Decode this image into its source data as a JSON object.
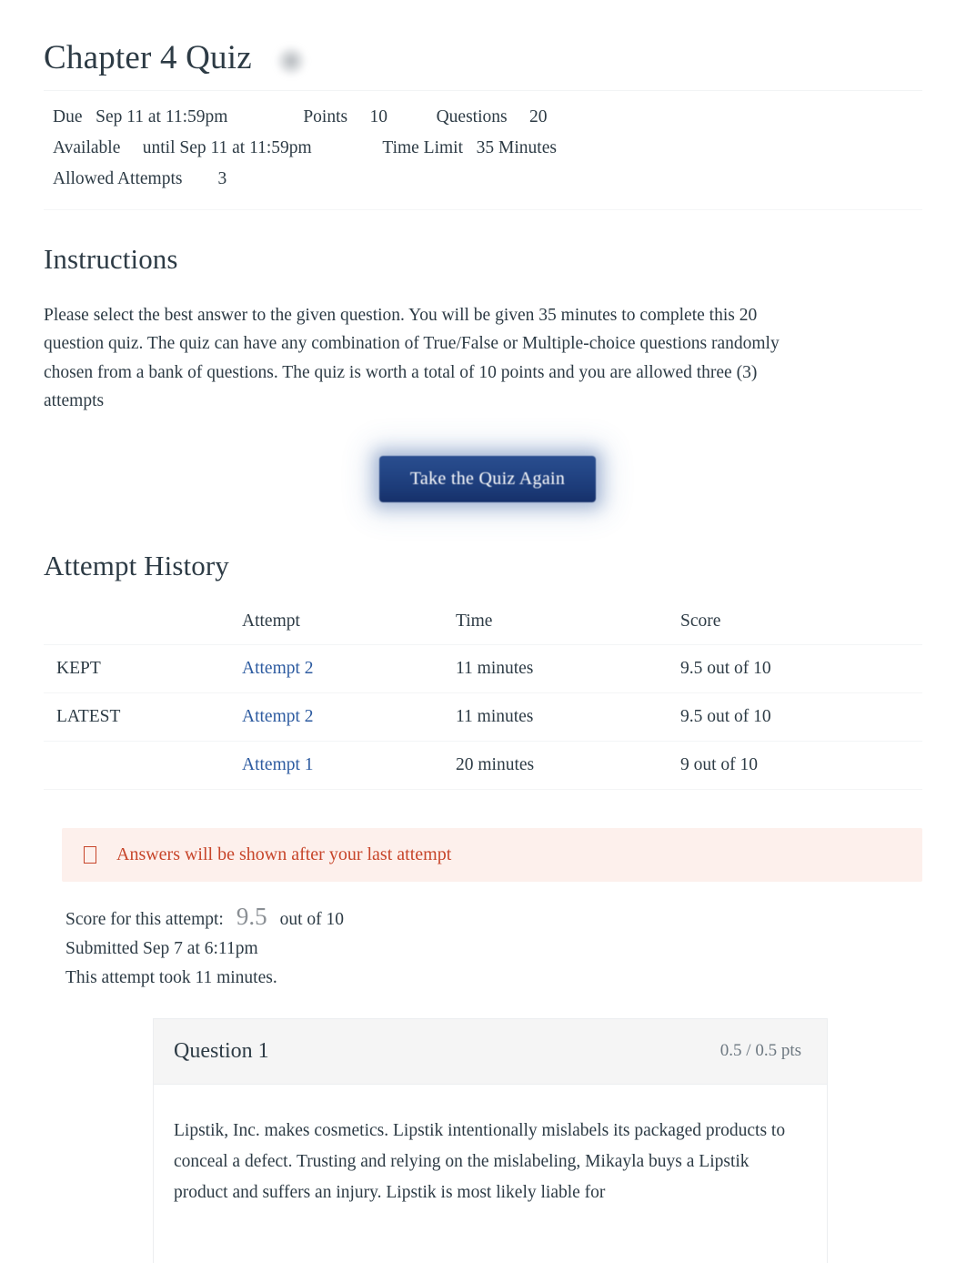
{
  "header": {
    "title": "Chapter 4 Quiz",
    "decoration_icon": "blurred-gray-blob-icon"
  },
  "quiz_meta": {
    "line1": "Due   Sep 11 at 11:59pm                 Points     10           Questions     20",
    "line2": "Available     until Sep 11 at 11:59pm                Time Limit   35 Minutes",
    "line3": "Allowed Attempts        3",
    "fields": {
      "due_label": "Due",
      "due_value": "Sep 11 at 11:59pm",
      "points_label": "Points",
      "points_value": "10",
      "questions_label": "Questions",
      "questions_value": "20",
      "available_label": "Available",
      "available_value": "until Sep 11 at 11:59pm",
      "time_limit_label": "Time Limit",
      "time_limit_value": "35 Minutes",
      "allowed_attempts_label": "Allowed Attempts",
      "allowed_attempts_value": "3"
    }
  },
  "instructions": {
    "heading": "Instructions",
    "body": "Please select the best answer to the given question. You will be given 35 minutes to complete this 20 question quiz. The quiz can have any combination of True/False or Multiple-choice questions randomly chosen from a bank of questions. The quiz is worth a total of 10 points and you are allowed three (3) attempts"
  },
  "actions": {
    "take_quiz_again": "Take the Quiz Again"
  },
  "attempt_history": {
    "heading": "Attempt History",
    "columns": [
      "",
      "Attempt",
      "Time",
      "Score"
    ],
    "rows": [
      {
        "label": "KEPT",
        "attempt": "Attempt 2",
        "time": "11 minutes",
        "score": "9.5 out of 10"
      },
      {
        "label": "LATEST",
        "attempt": "Attempt 2",
        "time": "11 minutes",
        "score": "9.5 out of 10"
      },
      {
        "label": "",
        "attempt": "Attempt 1",
        "time": "20 minutes",
        "score": "9 out of 10"
      }
    ]
  },
  "alert": {
    "icon": "warning-icon",
    "text": "Answers will be shown after your last attempt",
    "text_color": "#c7452a",
    "background_color": "#fdf0ec"
  },
  "score_summary": {
    "score_label": "Score for this attempt:",
    "score_value": "9.5",
    "score_suffix": "out of 10",
    "submitted": "Submitted Sep 7 at 6:11pm",
    "duration": "This attempt took 11 minutes."
  },
  "question": {
    "name": "Question 1",
    "points": "0.5 / 0.5 pts",
    "text": "Lipstik, Inc. makes cosmetics. Lipstik intentionally mislabels its packaged products to conceal a defect. Trusting and relying on the mislabeling, Mikayla buys a Lipstik product and suffers an injury. Lipstik is most likely liable for"
  },
  "colors": {
    "link": "#2d5ba0",
    "button_blue": "#234585",
    "alert_red": "#c7452a",
    "text": "#2d3b45",
    "muted": "#6c7780"
  }
}
